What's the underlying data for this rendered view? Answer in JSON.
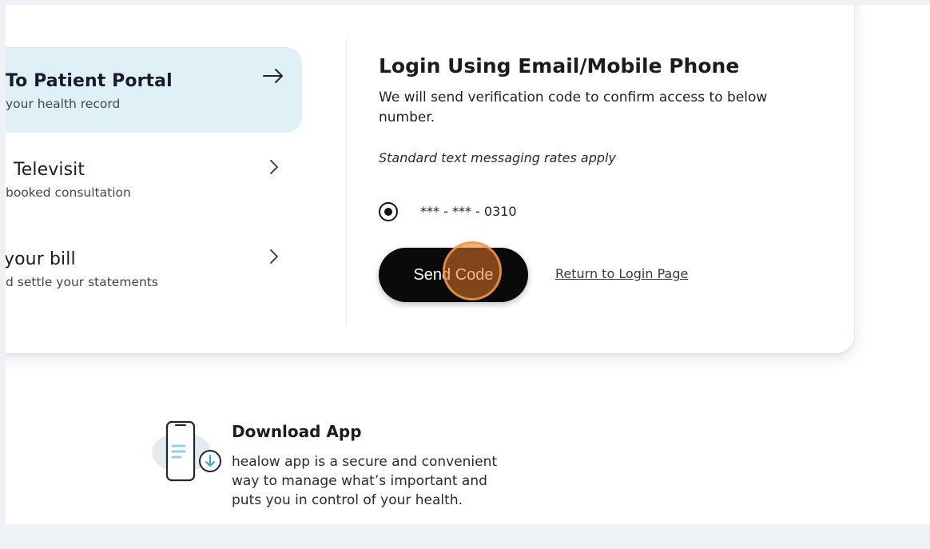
{
  "nav": {
    "items": [
      {
        "title": "To Patient Portal",
        "subtitle": "your health record",
        "active": true,
        "indicator": "arrow-right-icon"
      },
      {
        "title": "Televisit",
        "subtitle": "booked consultation",
        "active": false,
        "indicator": "chevron-right-icon"
      },
      {
        "title": "your bill",
        "subtitle": "d settle your statements",
        "active": false,
        "indicator": "chevron-right-icon"
      }
    ]
  },
  "login": {
    "title": "Login Using Email/Mobile Phone",
    "description": "We will send verification code to confirm access to below number.",
    "rates_note": "Standard text messaging rates apply",
    "phone_option": "*** - *** - 0310",
    "send_button": "Send Code",
    "return_link": "Return to Login Page"
  },
  "download": {
    "title": "Download App",
    "description": "healow app is a secure and convenient way to manage what’s important and puts you in control of your health."
  },
  "colors": {
    "page_bg": "#eef2f6",
    "active_nav_bg": "#dff0f6",
    "button_bg": "#0a0a0a",
    "click_highlight": "#e27828",
    "app_icon_accent": "#8fd0e8"
  }
}
